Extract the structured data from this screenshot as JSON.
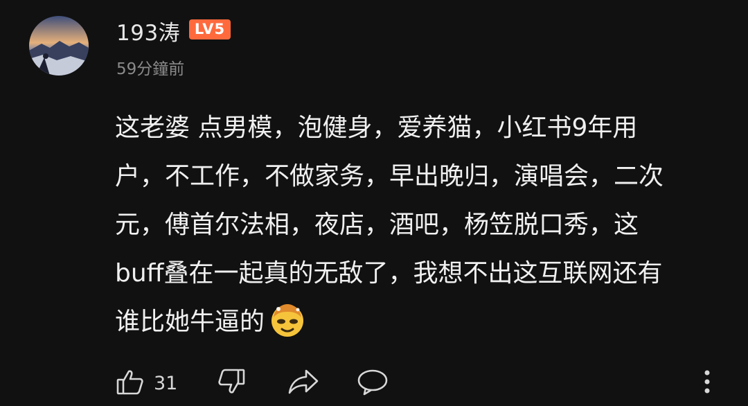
{
  "comment": {
    "username": "193涛",
    "level_badge": "LV5",
    "timestamp": "59分鐘前",
    "body_lines": [
      "这老婆 点男模，泡健身，爱养猫，小红书9年用",
      "户，不工作，不做家务，早出晚归，演唱会，二次",
      "元，傅首尔法相，夜店，酒吧，杨笠脱口秀，这",
      "buff叠在一起真的无敌了，我想不出这互联网还有",
      "谁比她牛逼的"
    ],
    "emoji": "mind-blown-emoji"
  },
  "actions": {
    "like_count": "31",
    "icons": [
      "thumbs-up-icon",
      "thumbs-down-icon",
      "share-icon",
      "reply-icon",
      "more-vert-icon"
    ]
  },
  "colors": {
    "background": "#111111",
    "text": "#f0f0f0",
    "muted": "#8a8a8a",
    "badge": "#ff6a3d"
  }
}
